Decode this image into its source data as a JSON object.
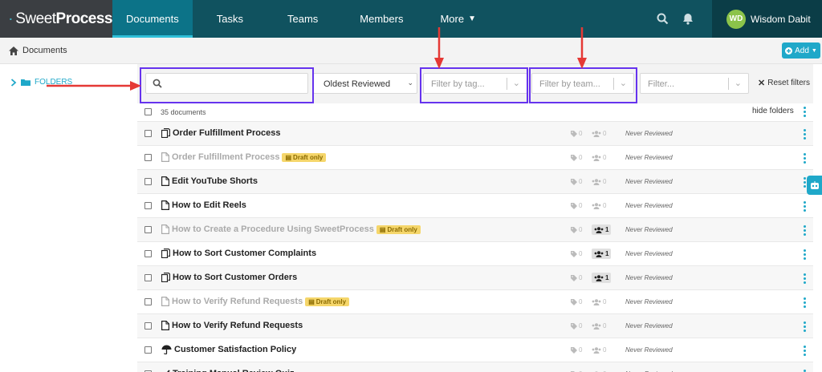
{
  "app": {
    "logo_text_light": "Sweet",
    "logo_text_bold": "Process"
  },
  "nav": {
    "items": [
      {
        "label": "Documents",
        "active": true
      },
      {
        "label": "Tasks"
      },
      {
        "label": "Teams"
      },
      {
        "label": "Members"
      },
      {
        "label": "More"
      }
    ],
    "user_initials": "WD",
    "user_name": "Wisdom Dabit"
  },
  "breadcrumb": {
    "label": "Documents"
  },
  "add_button": {
    "label": "Add"
  },
  "sidebar": {
    "folders_label": "FOLDERS"
  },
  "filters": {
    "search_value": "",
    "sort_value": "Oldest Reviewed",
    "tag_placeholder": "Filter by tag...",
    "team_placeholder": "Filter by team...",
    "filter_placeholder": "Filter...",
    "reset_label": "Reset filters"
  },
  "list": {
    "count_label": "35 documents",
    "hide_folders_label": "hide folders",
    "draft_badge": "Draft only",
    "rows": [
      {
        "title": "Order Fulfillment Process",
        "icon": "copy-icon",
        "draft": false,
        "tags": "0",
        "teams": "0",
        "status": "Never Reviewed"
      },
      {
        "title": "Order Fulfillment Process",
        "icon": "document-icon",
        "draft": true,
        "tags": "0",
        "teams": "0",
        "status": "Never Reviewed"
      },
      {
        "title": "Edit YouTube Shorts",
        "icon": "document-icon",
        "draft": false,
        "tags": "0",
        "teams": "0",
        "status": "Never Reviewed"
      },
      {
        "title": "How to Edit Reels",
        "icon": "document-icon",
        "draft": false,
        "tags": "0",
        "teams": "0",
        "status": "Never Reviewed"
      },
      {
        "title": "How to Create a Procedure Using SweetProcess",
        "icon": "document-icon",
        "draft": true,
        "tags": "0",
        "teams": "1",
        "status": "Never Reviewed"
      },
      {
        "title": "How to Sort Customer Complaints",
        "icon": "copy-icon",
        "draft": false,
        "tags": "0",
        "teams": "1",
        "status": "Never Reviewed"
      },
      {
        "title": "How to Sort Customer Orders",
        "icon": "copy-icon",
        "draft": false,
        "tags": "0",
        "teams": "1",
        "status": "Never Reviewed"
      },
      {
        "title": "How to Verify Refund Requests",
        "icon": "document-icon",
        "draft": true,
        "tags": "0",
        "teams": "0",
        "status": "Never Reviewed"
      },
      {
        "title": "How to Verify Refund Requests",
        "icon": "document-icon",
        "draft": false,
        "tags": "0",
        "teams": "0",
        "status": "Never Reviewed"
      },
      {
        "title": "Customer Satisfaction Policy",
        "icon": "umbrella-icon",
        "draft": false,
        "tags": "0",
        "teams": "0",
        "status": "Never Reviewed"
      },
      {
        "title": "Training Manual Review Quiz",
        "icon": "check-icon",
        "draft": false,
        "tags": "0",
        "teams": "0",
        "status": "Never Reviewed"
      }
    ]
  },
  "colors": {
    "nav_bg": "#10525f",
    "accent": "#1fa8c9",
    "annotation_box": "#6633ee",
    "annotation_arrow": "#e53935"
  }
}
